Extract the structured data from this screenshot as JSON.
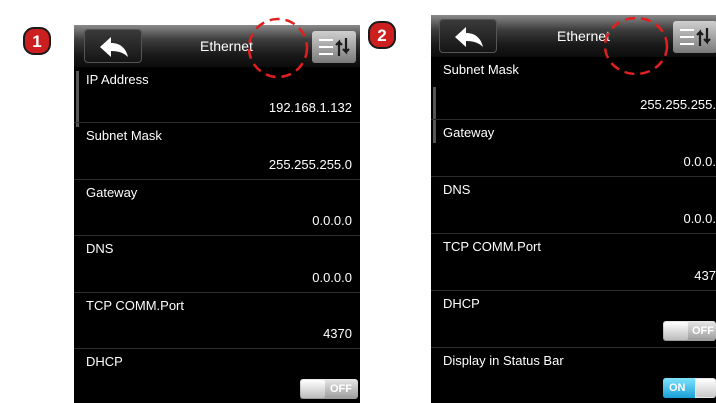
{
  "step_badges": [
    "1",
    "2"
  ],
  "screen1": {
    "title": "Ethernet",
    "rows": [
      {
        "label": "IP Address",
        "value": "192.168.1.132"
      },
      {
        "label": "Subnet Mask",
        "value": "255.255.255.0"
      },
      {
        "label": "Gateway",
        "value": "0.0.0.0"
      },
      {
        "label": "DNS",
        "value": "0.0.0.0"
      },
      {
        "label": "TCP COMM.Port",
        "value": "4370"
      },
      {
        "label": "DHCP",
        "toggle": "OFF"
      }
    ]
  },
  "screen2": {
    "title": "Ethernet",
    "rows": [
      {
        "label": "Subnet Mask",
        "value": "255.255.255."
      },
      {
        "label": "Gateway",
        "value": "0.0.0."
      },
      {
        "label": "DNS",
        "value": "0.0.0."
      },
      {
        "label": "TCP COMM.Port",
        "value": "437"
      },
      {
        "label": "DHCP",
        "toggle": "OFF"
      },
      {
        "label": "Display in Status Bar",
        "toggle": "ON"
      }
    ]
  },
  "icons": {
    "badge": "numbered-step-badge",
    "back": "back-arrow-icon",
    "sort": "sort-menu-icon",
    "highlight": "dashed-highlight-circle"
  },
  "colors": {
    "badge_fill": "#cc1f1f",
    "highlight": "#e02020",
    "toggle_on": "#1a9fd6",
    "screen_bg": "#000000",
    "text": "#ffffff"
  }
}
